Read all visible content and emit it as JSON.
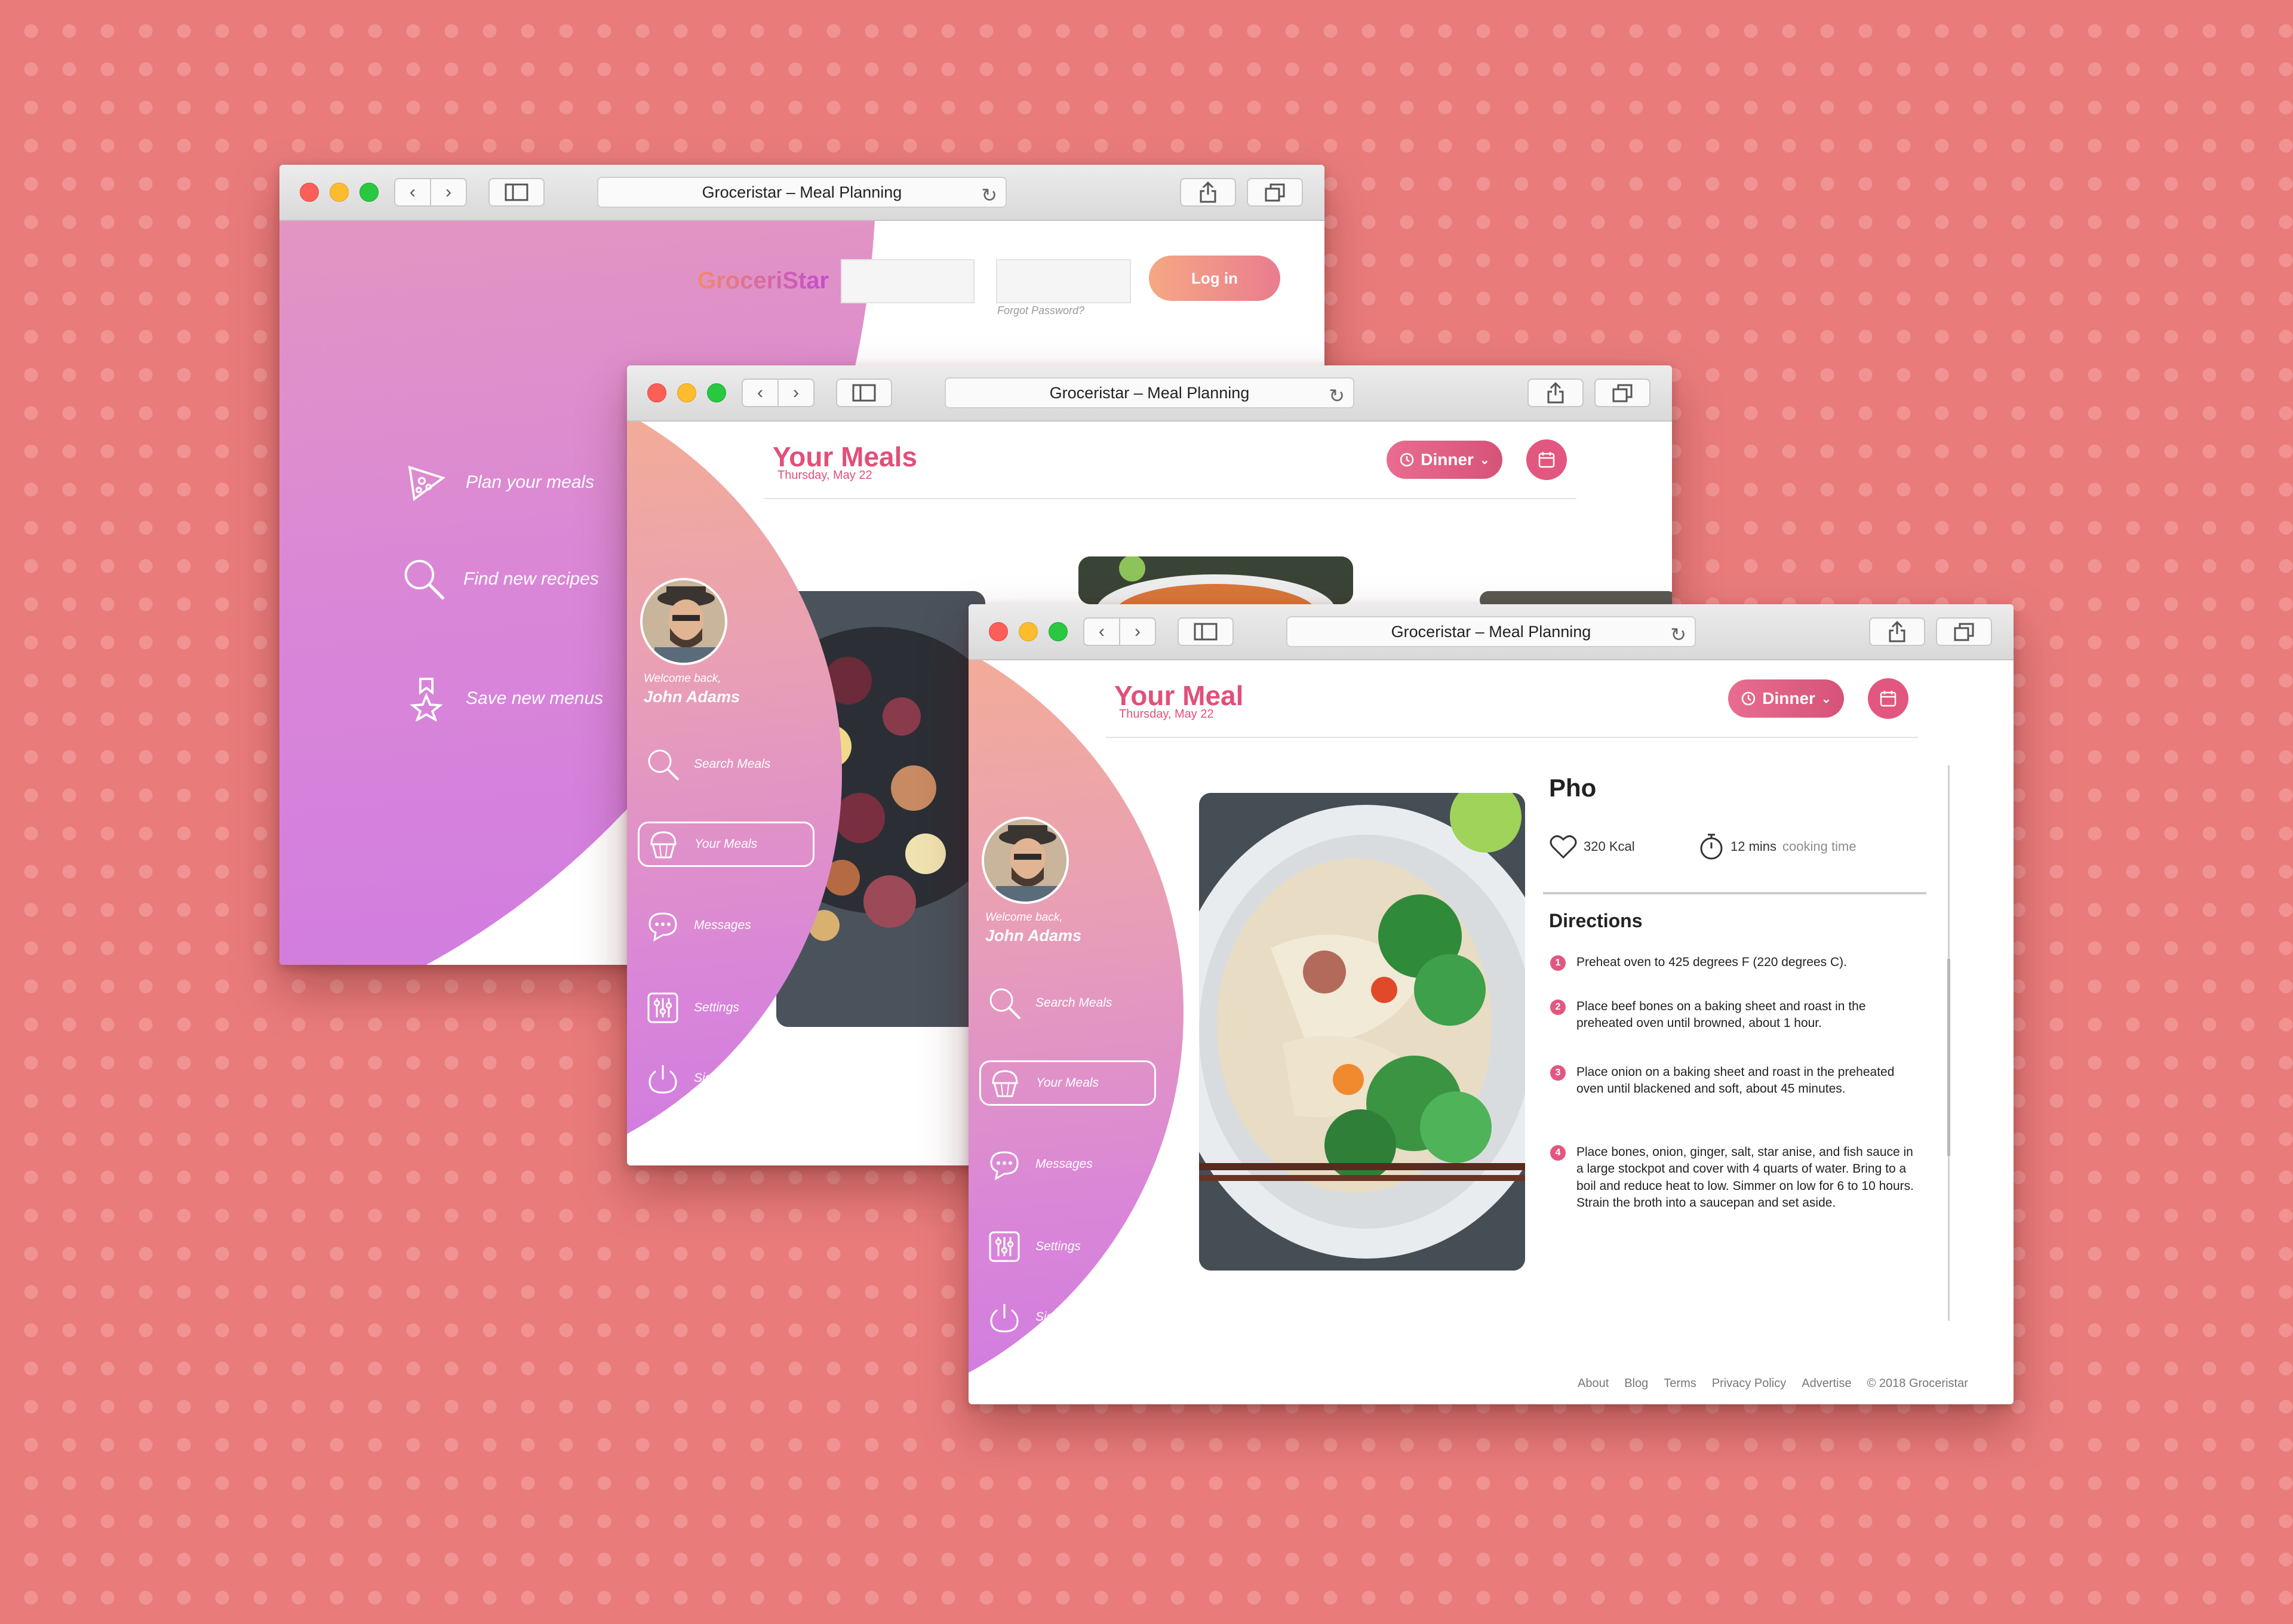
{
  "browser": {
    "title": "Groceristar – Meal Planning"
  },
  "landing": {
    "brand": "GroceriStar",
    "forgot": "Forgot Password?",
    "login_label": "Log in",
    "features": [
      {
        "label": "Plan your meals",
        "icon": "pizza-slice-icon"
      },
      {
        "label": "Find new recipes",
        "icon": "search-icon"
      },
      {
        "label": "Save new menus",
        "icon": "bookmark-star-icon"
      }
    ]
  },
  "meals_page": {
    "title": "Your Meals",
    "date": "Thursday, May 22",
    "meal_select": "Dinner"
  },
  "meal_page": {
    "title": "Your Meal",
    "date": "Thursday, May 22",
    "meal_select": "Dinner"
  },
  "sidebar": {
    "welcome": "Welcome back,",
    "user_name": "John Adams",
    "items": [
      {
        "label": "Search Meals",
        "icon": "search-icon"
      },
      {
        "label": "Your Meals",
        "icon": "cupcake-icon"
      },
      {
        "label": "Messages",
        "icon": "chat-bubble-icon"
      },
      {
        "label": "Settings",
        "icon": "sliders-icon"
      },
      {
        "label": "Sign Out",
        "icon": "power-icon"
      }
    ]
  },
  "recipe": {
    "name": "Pho",
    "calories": "320 Kcal",
    "time_value": "12 mins",
    "time_label": "cooking time",
    "directions_title": "Directions",
    "steps": [
      "Preheat oven to 425 degrees F (220 degrees C).",
      "Place beef bones on a baking sheet and roast in the preheated oven until browned, about 1 hour.",
      "Place onion on a baking sheet and roast in the preheated oven until blackened and soft, about 45 minutes.",
      "Place bones, onion, ginger, salt, star anise, and fish sauce in a large stockpot and cover with 4 quarts of water. Bring to a boil and reduce heat to low. Simmer on low for 6 to 10 hours. Strain the broth into a saucepan and set aside."
    ]
  },
  "footer": {
    "links": [
      "About",
      "Blog",
      "Terms",
      "Privacy Policy",
      "Advertise"
    ],
    "copyright": "© 2018 Groceristar"
  },
  "colors": {
    "background": "#e97b7b",
    "accent": "#e1507a",
    "gradient_top": "#f7b18b",
    "gradient_bottom": "#cf7ae2"
  }
}
